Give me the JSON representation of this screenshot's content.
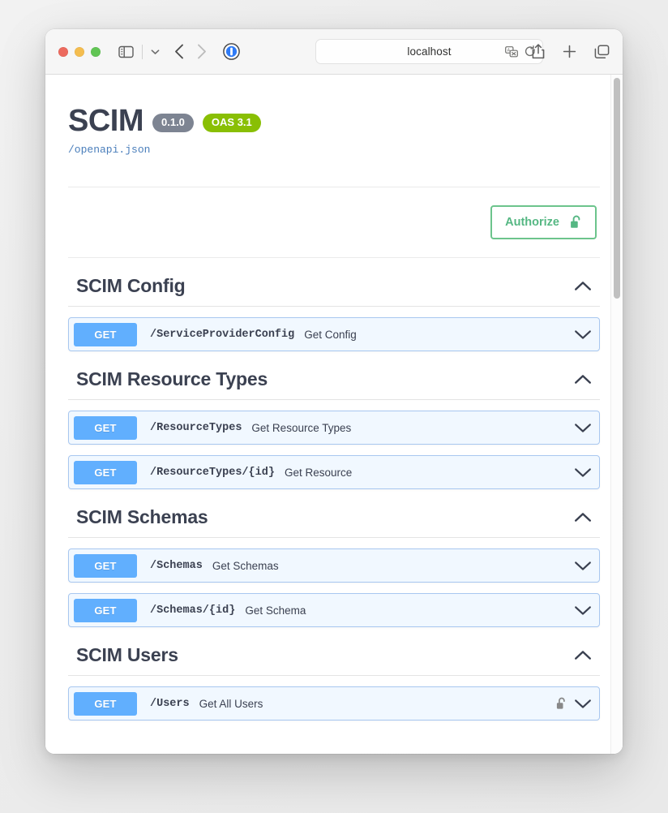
{
  "browser": {
    "traffic_lights": [
      "close",
      "minimize",
      "zoom"
    ],
    "url_value": "localhost",
    "toolbar_icons": [
      "sidebar-toggle-icon",
      "chevron-down-icon",
      "back-icon",
      "forward-icon",
      "onepassword-icon",
      "translate-icon",
      "reload-icon",
      "share-icon",
      "new-tab-icon",
      "tab-overview-icon"
    ]
  },
  "info": {
    "title": "SCIM",
    "version_badge": "0.1.0",
    "oas_badge": "OAS 3.1",
    "spec_link": "/openapi.json"
  },
  "auth": {
    "authorize_label": "Authorize",
    "lock_icon": "unlocked-padlock-icon"
  },
  "colors": {
    "get_method": "#61affe",
    "op_block_bg": "#f1f8ff",
    "op_block_border": "#a8c7f0",
    "authorize_green": "#6cc48c",
    "oas_badge_green": "#89bf04",
    "version_badge_gray": "#7d8492",
    "title_text": "#3b4151",
    "spec_link_blue": "#4a7ebb"
  },
  "tags": [
    {
      "name": "SCIM Config",
      "expanded": true,
      "operations": [
        {
          "method": "GET",
          "path": "/ServiceProviderConfig",
          "summary": "Get Config",
          "locked": false
        }
      ]
    },
    {
      "name": "SCIM Resource Types",
      "expanded": true,
      "operations": [
        {
          "method": "GET",
          "path": "/ResourceTypes",
          "summary": "Get Resource Types",
          "locked": false
        },
        {
          "method": "GET",
          "path": "/ResourceTypes/{id}",
          "summary": "Get Resource",
          "locked": false
        }
      ]
    },
    {
      "name": "SCIM Schemas",
      "expanded": true,
      "operations": [
        {
          "method": "GET",
          "path": "/Schemas",
          "summary": "Get Schemas",
          "locked": false
        },
        {
          "method": "GET",
          "path": "/Schemas/{id}",
          "summary": "Get Schema",
          "locked": false
        }
      ]
    },
    {
      "name": "SCIM Users",
      "expanded": true,
      "operations": [
        {
          "method": "GET",
          "path": "/Users",
          "summary": "Get All Users",
          "locked": true
        }
      ]
    }
  ]
}
